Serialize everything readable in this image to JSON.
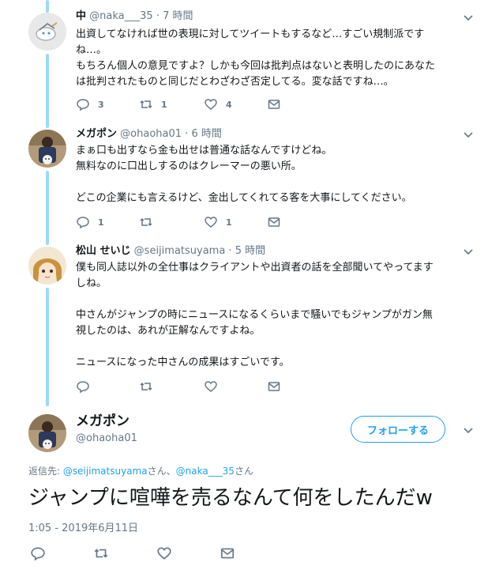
{
  "tweets": [
    {
      "name": "中",
      "handle": "@naka___35",
      "dot": "·",
      "time": "7 時間",
      "lines": [
        "出資してなければ世の表現に対してツイートもするなど…すごい規制派です",
        "ね…。",
        "もちろん個人の意見ですよ？しかも今回は批判点はないと表明したのにあなた",
        "は批判されたものと同じだとわざわざ否定してる。変な話ですね…。"
      ],
      "reply_count": "3",
      "retweet_count": "1",
      "like_count": "4"
    },
    {
      "name": "メガポン",
      "handle": "@ohaoha01",
      "dot": "·",
      "time": "6 時間",
      "lines": [
        "まぁ口も出すなら金も出せは普通な話なんですけどね。",
        "無料なのに口出しするのはクレーマーの悪い所。",
        "",
        "どこの企業にも言えるけど、金出してくれてる客を大事にしてください。"
      ],
      "reply_count": "1",
      "retweet_count": "",
      "like_count": "1"
    },
    {
      "name": "松山 せいじ",
      "handle": "@seijimatsuyama",
      "dot": "·",
      "time": "5 時間",
      "lines": [
        "僕も同人誌以外の全仕事はクライアントや出資者の話を全部聞いてやってます",
        "しね。",
        "",
        "中さんがジャンプの時にニュースになるくらいまで騒いでもジャンプがガン無",
        "視したのは、あれが正解なんですよね。",
        "",
        "ニュースになった中さんの成果はすごいです。"
      ],
      "reply_count": "",
      "retweet_count": "",
      "like_count": ""
    }
  ],
  "main": {
    "name": "メガポン",
    "handle": "@ohaoha01",
    "follow_label": "フォローする",
    "reply_prefix": "返信先: ",
    "mention1": "@seijimatsuyama",
    "san1": "さん、",
    "mention2": "@naka___35",
    "san2": "さん",
    "text": "ジャンプに喧嘩を売るなんて何をしたんだw",
    "timestamp": "1:05 - 2019年6月11日"
  },
  "icons": {
    "reply": "reply-icon",
    "retweet": "retweet-icon",
    "like": "heart-icon",
    "dm": "envelope-icon",
    "caret": "chevron-down-icon"
  },
  "colors": {
    "accent": "#1da1f2",
    "thread_line": "#9fd9f3",
    "secondary_text": "#657786",
    "primary_text": "#14171a"
  }
}
